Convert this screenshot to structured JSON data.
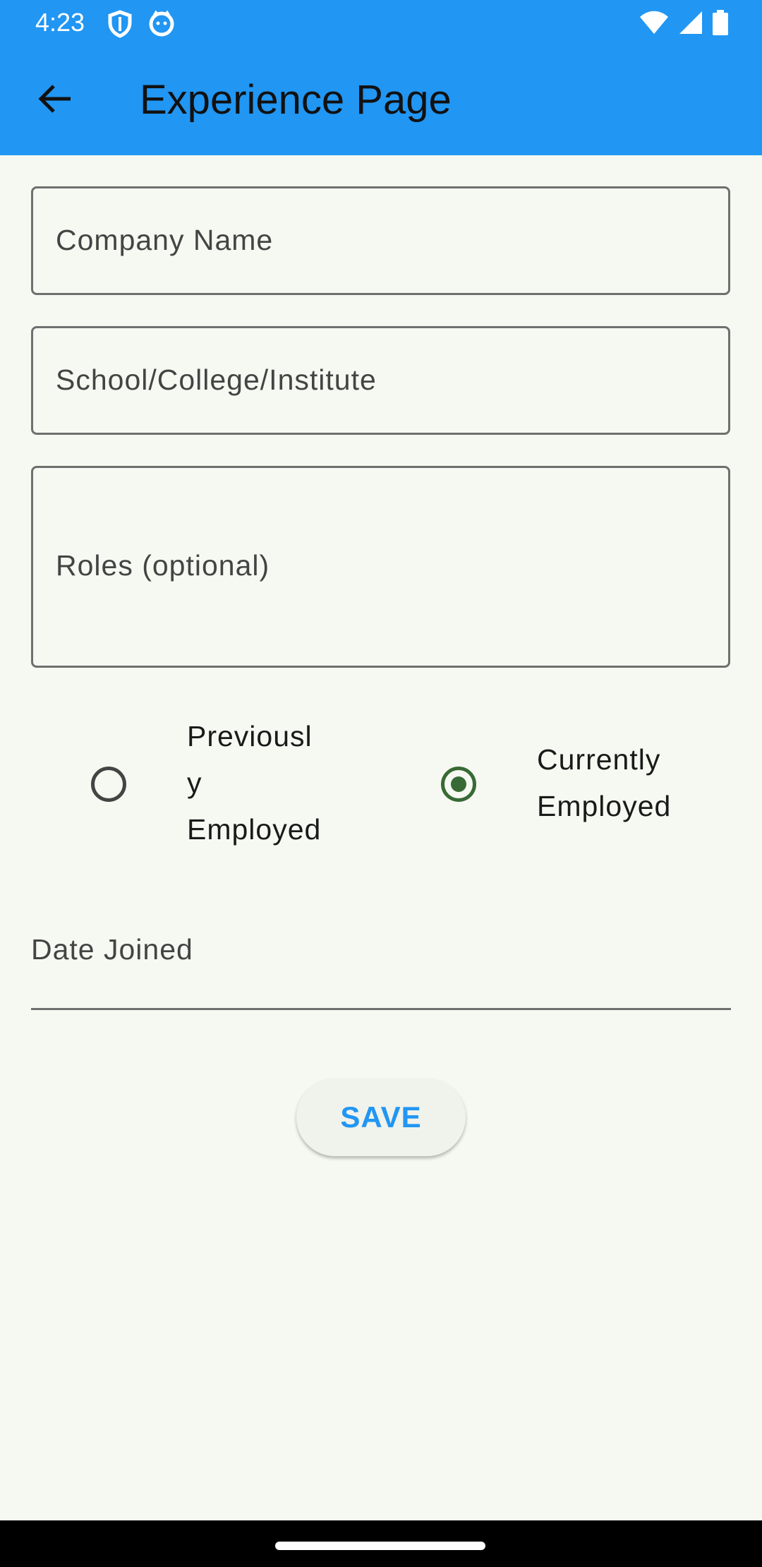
{
  "status_bar": {
    "time": "4:23",
    "left_icons": [
      "shield-icon",
      "cat-face-icon"
    ],
    "right_icons": [
      "wifi-icon",
      "cellular-signal-icon",
      "battery-icon"
    ]
  },
  "app_bar": {
    "title": "Experience Page",
    "back_icon": "arrow-back-icon",
    "background_color": "#2196f3"
  },
  "form": {
    "company_name_label": "Company Name",
    "school_label": "School/College/Institute",
    "roles_label": "Roles (optional)",
    "employment_status": {
      "options": [
        {
          "lines": [
            "Previousl",
            "y",
            "Employed"
          ],
          "selected": false
        },
        {
          "lines": [
            "Currently",
            "Employed"
          ],
          "selected": true
        }
      ],
      "selected_color": "#386a35"
    },
    "date_joined_label": "Date Joined",
    "save_label": "SAVE",
    "save_color": "#2196f3"
  }
}
